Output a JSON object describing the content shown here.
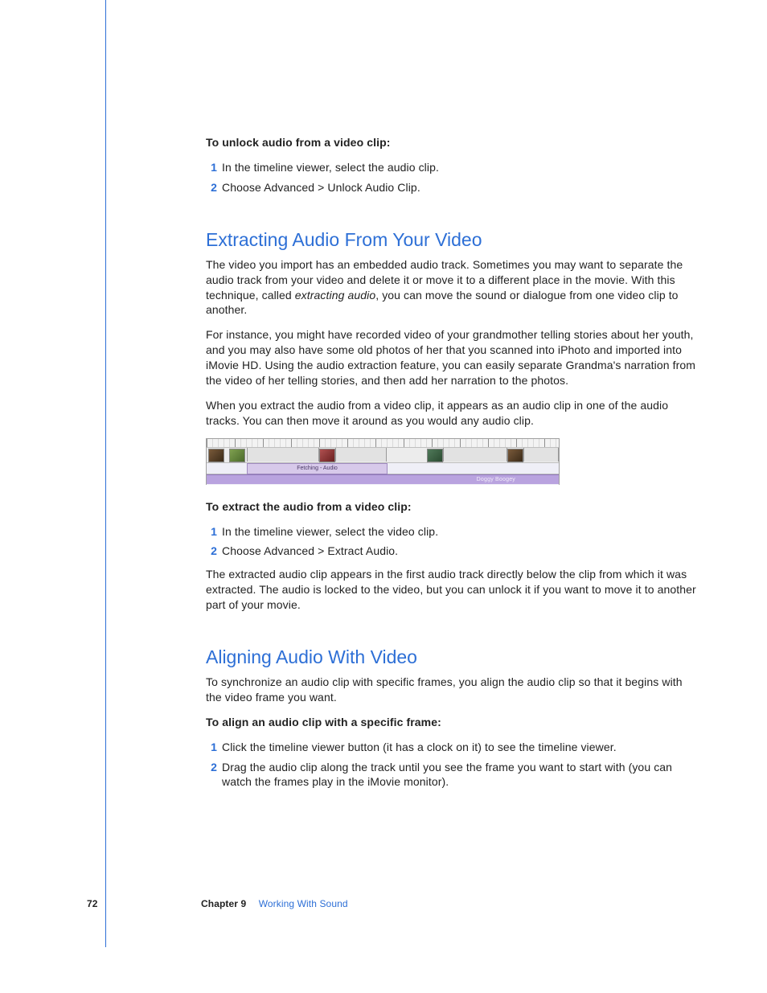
{
  "unlock": {
    "heading": "To unlock audio from a video clip:",
    "step1": "In the timeline viewer, select the audio clip.",
    "step2": "Choose Advanced > Unlock Audio Clip."
  },
  "extract": {
    "title": "Extracting Audio From Your Video",
    "p1a": "The video you import has an embedded audio track. Sometimes you may want to separate the audio track from your video and delete it or move it to a different place in the movie. With this technique, called ",
    "p1em": "extracting audio",
    "p1b": ", you can move the sound or dialogue from one video clip to another.",
    "p2": "For instance, you might have recorded video of your grandmother telling stories about her youth, and you may also have some old photos of her that you scanned into iPhoto and imported into iMovie HD. Using the audio extraction feature, you can easily separate Grandma's narration from the video of her telling stories, and then add her narration to the photos.",
    "p3": "When you extract the audio from a video clip, it appears as an audio clip in one of the audio tracks. You can then move it around as you would any audio clip.",
    "fig_audio1": "Fetching - Audio",
    "fig_audio2": "Doggy Boogey",
    "steps_heading": "To extract the audio from a video clip:",
    "step1": "In the timeline viewer, select the video clip.",
    "step2": "Choose Advanced > Extract Audio.",
    "note": "The extracted audio clip appears in the first audio track directly below the clip from which it was extracted. The audio is locked to the video, but you can unlock it if you want to move it to another part of your movie."
  },
  "align": {
    "title": "Aligning Audio With Video",
    "p1": "To synchronize an audio clip with specific frames, you align the audio clip so that it begins with the video frame you want.",
    "steps_heading": "To align an audio clip with a specific frame:",
    "step1": "Click the timeline viewer button (it has a clock on it) to see the timeline viewer.",
    "step2": "Drag the audio clip along the track until you see the frame you want to start with (you can watch the frames play in the iMovie monitor)."
  },
  "footer": {
    "page": "72",
    "chapter_label": "Chapter 9",
    "chapter_title": "Working With Sound"
  },
  "nums": {
    "n1": "1",
    "n2": "2"
  }
}
